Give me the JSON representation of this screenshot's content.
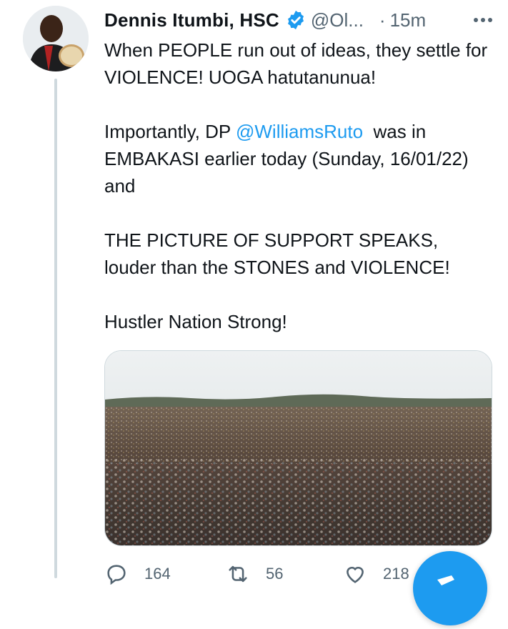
{
  "tweet": {
    "author_name": "Dennis Itumbi, HSC",
    "handle": "@Ol",
    "handle_ellipsis": "...",
    "separator": "·",
    "timestamp": "15m",
    "verified": true,
    "text": {
      "p1": "When PEOPLE run out of ideas, they settle for VIOLENCE! UOGA hatutanunua!",
      "p2_before": "Importantly, DP ",
      "p2_mention": "@WilliamsRuto",
      "p2_after": "  was in EMBAKASI earlier today (Sunday, 16/01/22) and",
      "p3": "THE PICTURE OF SUPPORT SPEAKS, louder than the STONES and VIOLENCE!",
      "p4": "Hustler Nation Strong!"
    },
    "media": {
      "description": "crowd-photo"
    },
    "actions": {
      "reply_count": "164",
      "retweet_count": "56",
      "like_count": "218"
    }
  },
  "colors": {
    "accent": "#1d9bf0",
    "secondary_text": "#536471",
    "border": "#cfd9de"
  },
  "icons": [
    "more-icon",
    "verified-icon",
    "reply-icon",
    "retweet-icon",
    "like-icon",
    "compose-fab"
  ]
}
